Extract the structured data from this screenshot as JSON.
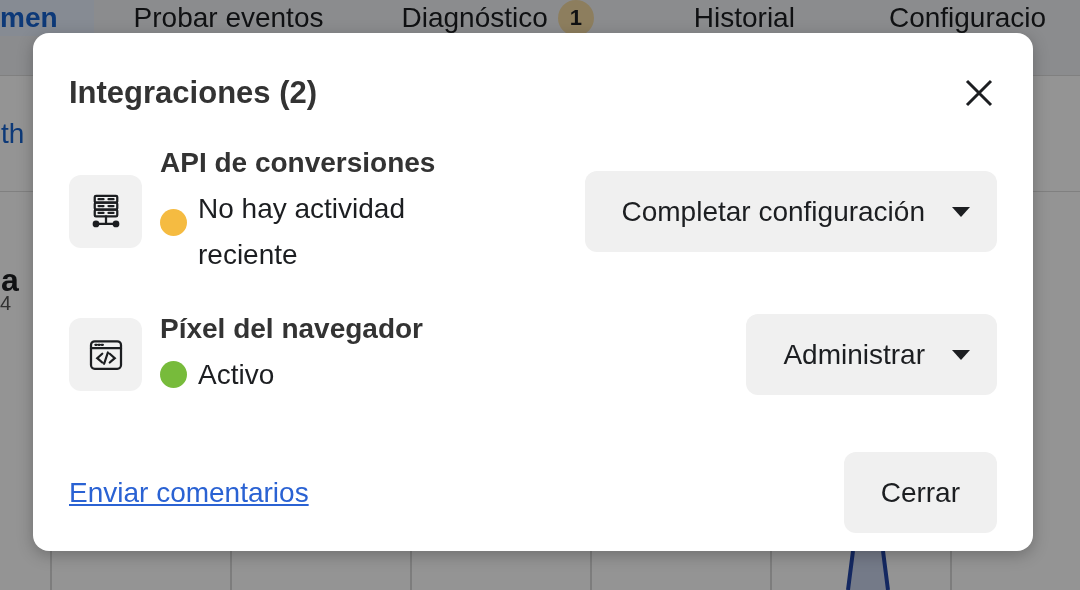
{
  "background": {
    "tabs": [
      {
        "label": "men",
        "selected": true
      },
      {
        "label": "Probar eventos",
        "selected": false
      },
      {
        "label": "Diagnóstico",
        "selected": false,
        "badge": "1"
      },
      {
        "label": "Historial",
        "selected": false
      },
      {
        "label": "Configuracio",
        "selected": false
      }
    ],
    "link_fragment": "th",
    "heading_fragment": "a",
    "axis_label": "4"
  },
  "dialog": {
    "title": "Integraciones (2)",
    "integrations": [
      {
        "name": "API de conversiones",
        "status": "No hay actividad reciente",
        "color": "#f5bb41",
        "action": "Completar configuración"
      },
      {
        "name": "Píxel del navegador",
        "status": "Activo",
        "color": "#77bb3b",
        "action": "Administrar"
      }
    ],
    "feedback_link": "Enviar comentarios",
    "close_button": "Cerrar"
  }
}
